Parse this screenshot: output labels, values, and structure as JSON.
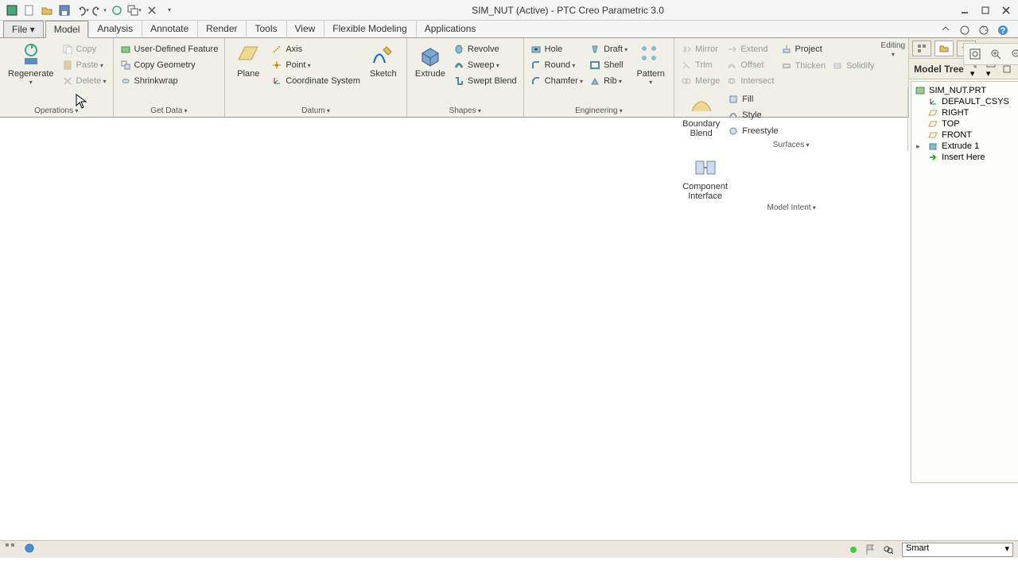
{
  "title": "SIM_NUT (Active) - PTC Creo Parametric 3.0",
  "tabs": {
    "file": "File ▾",
    "list": [
      "Model",
      "Analysis",
      "Annotate",
      "Render",
      "Tools",
      "View",
      "Flexible Modeling",
      "Applications"
    ],
    "active": 0
  },
  "ribbon": {
    "operations": {
      "label": "Operations",
      "regenerate": "Regenerate",
      "copy": "Copy",
      "paste": "Paste",
      "delete": "Delete"
    },
    "getdata": {
      "label": "Get Data",
      "udf": "User-Defined Feature",
      "copygeom": "Copy Geometry",
      "shrinkwrap": "Shrinkwrap"
    },
    "datum": {
      "label": "Datum",
      "plane": "Plane",
      "axis": "Axis",
      "point": "Point",
      "csys": "Coordinate System",
      "sketch": "Sketch"
    },
    "shapes": {
      "label": "Shapes",
      "extrude": "Extrude",
      "revolve": "Revolve",
      "sweep": "Sweep",
      "sweptblend": "Swept Blend"
    },
    "engineering": {
      "label": "Engineering",
      "hole": "Hole",
      "round": "Round",
      "chamfer": "Chamfer",
      "draft": "Draft",
      "shell": "Shell",
      "rib": "Rib",
      "pattern": "Pattern"
    },
    "editing": {
      "label": "Editing",
      "mirror": "Mirror",
      "trim": "Trim",
      "merge": "Merge",
      "extend": "Extend",
      "offset": "Offset",
      "intersect": "Intersect",
      "project": "Project",
      "thicken": "Thicken",
      "solidify": "Solidify"
    },
    "surfaces": {
      "label": "Surfaces",
      "boundaryblend": "Boundary\nBlend",
      "fill": "Fill",
      "style": "Style",
      "freestyle": "Freestyle"
    },
    "modelintent": {
      "label": "Model Intent",
      "compinterface": "Component\nInterface"
    }
  },
  "tree": {
    "title": "Model Tree",
    "root": "SIM_NUT.PRT",
    "items": [
      "DEFAULT_CSYS",
      "RIGHT",
      "TOP",
      "FRONT",
      "Extrude 1",
      "Insert Here"
    ]
  },
  "status": {
    "filter": "Smart"
  }
}
